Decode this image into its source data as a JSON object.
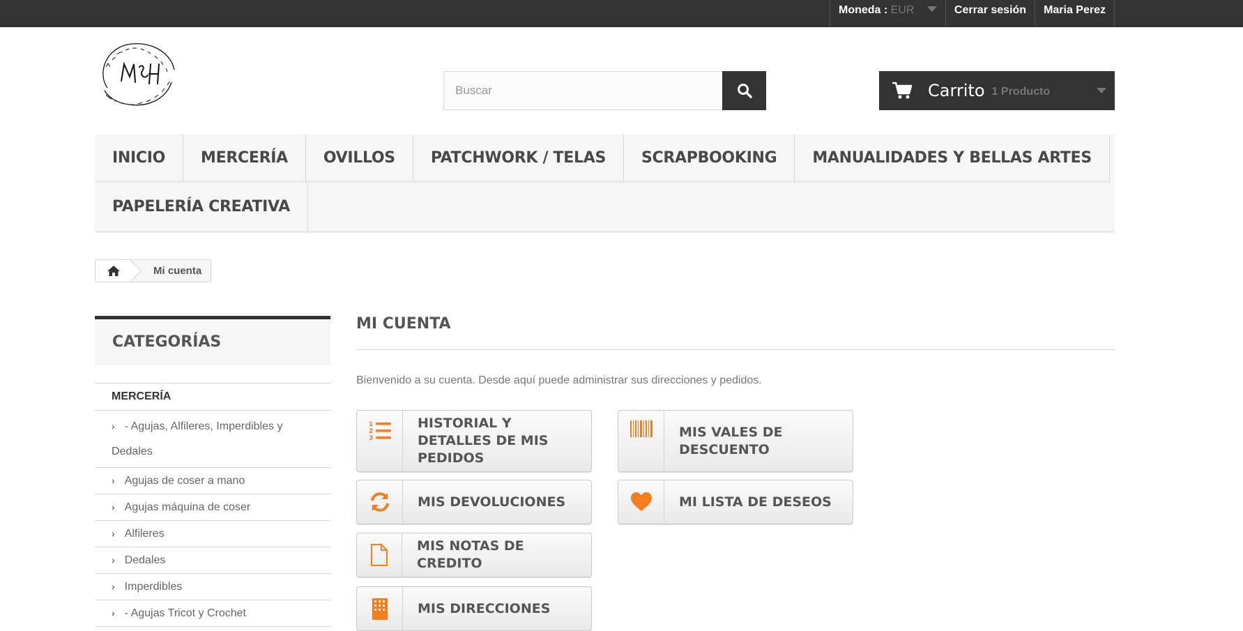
{
  "topbar": {
    "currency_label": "Moneda :",
    "currency_value": "EUR",
    "logout": "Cerrar sesión",
    "user_name": "Maria Perez"
  },
  "search": {
    "placeholder": "Buscar"
  },
  "cart": {
    "label": "Carrito",
    "count": "1 Producto"
  },
  "menu": {
    "items": [
      "INICIO",
      "MERCERÍA",
      "OVILLOS",
      "PATCHWORK / TELAS",
      "SCRAPBOOKING",
      "MANUALIDADES Y BELLAS ARTES",
      "PAPELERÍA CREATIVA"
    ]
  },
  "breadcrumb": {
    "current": "Mi cuenta"
  },
  "sidebar": {
    "title": "CATEGORÍAS",
    "root": "MERCERÍA",
    "items": [
      "- Agujas, Alfileres, Imperdibles y Dedales",
      "Agujas de coser a mano",
      "Agujas máquina de coser",
      "Alfileres",
      "Dedales",
      "Imperdibles",
      "- Agujas Tricot y Crochet"
    ]
  },
  "main": {
    "title": "MI CUENTA",
    "welcome": "Bienvenido a su cuenta. Desde aquí puede administrar sus direcciones y pedidos.",
    "buttons": {
      "history": "HISTORIAL Y DETALLES DE MIS PEDIDOS",
      "vouchers": "MIS VALES DE DESCUENTO",
      "returns": "MIS DEVOLUCIONES",
      "wishlist": "MI LISTA DE DESEOS",
      "credit_notes": "MIS NOTAS DE CREDITO",
      "addresses": "MIS DIRECCIONES"
    }
  },
  "colors": {
    "accent": "#f47d1e",
    "dark": "#333333"
  },
  "icons": [
    "search-icon",
    "cart-icon",
    "home-icon",
    "list-ordered-icon",
    "barcode-icon",
    "refresh-icon",
    "heart-icon",
    "file-icon",
    "building-icon"
  ]
}
